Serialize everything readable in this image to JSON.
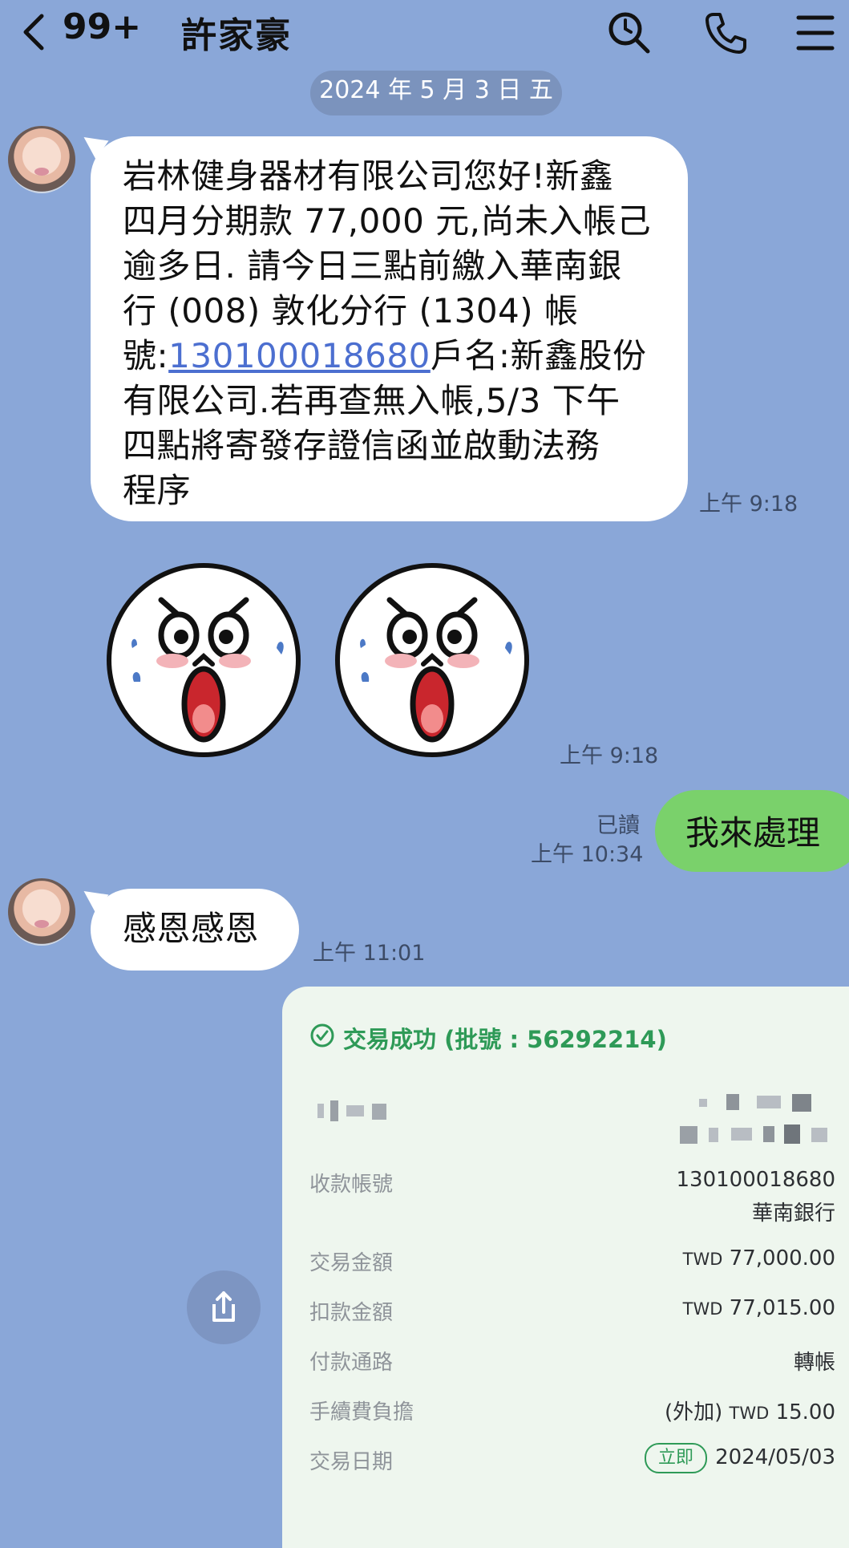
{
  "header": {
    "unread_count": "99+",
    "contact_name": "許家豪"
  },
  "date_divider": "2024 年 5 月 3 日 五",
  "messages": [
    {
      "text_before_link": "岩林健身器材有限公司您好!新鑫\n四月分期款 77,000 元,尚未入帳己\n逾多日. 請今日三點前繳入華南銀\n行 (008) 敦化分行 (1304) 帳\n號:",
      "link": "130100018680",
      "text_after_link": "戶名:新鑫股份\n有限公司.若再查無入帳,5/3 下午\n四點將寄發存證信函並啟動法務\n程序",
      "time": "上午 9:18"
    },
    {
      "sticker": "shocked-face-sticker",
      "time": "上午 9:18"
    },
    {
      "text": "我來處理",
      "read_label": "已讀",
      "time": "上午 10:34"
    },
    {
      "text": "感恩感恩",
      "time": "上午 11:01"
    }
  ],
  "transaction": {
    "status": "交易成功 (批號 : 56292214)",
    "rows": [
      {
        "label": "收款帳號",
        "value": "130100018680",
        "value2": "華南銀行"
      },
      {
        "label": "交易金額",
        "currency": "TWD",
        "value": "77,000.00"
      },
      {
        "label": "扣款金額",
        "currency": "TWD",
        "value": "77,015.00"
      },
      {
        "label": "付款通路",
        "value": "轉帳"
      },
      {
        "label": "手續費負擔",
        "prefix": "(外加)",
        "currency": "TWD",
        "value": "15.00"
      },
      {
        "label": "交易日期",
        "badge": "立即",
        "value": "2024/05/03"
      }
    ]
  },
  "colors": {
    "background": "#8aa7d8",
    "sent_bubble": "#7ad16b",
    "success_green": "#2e9a57",
    "link": "#4c6fd0"
  }
}
